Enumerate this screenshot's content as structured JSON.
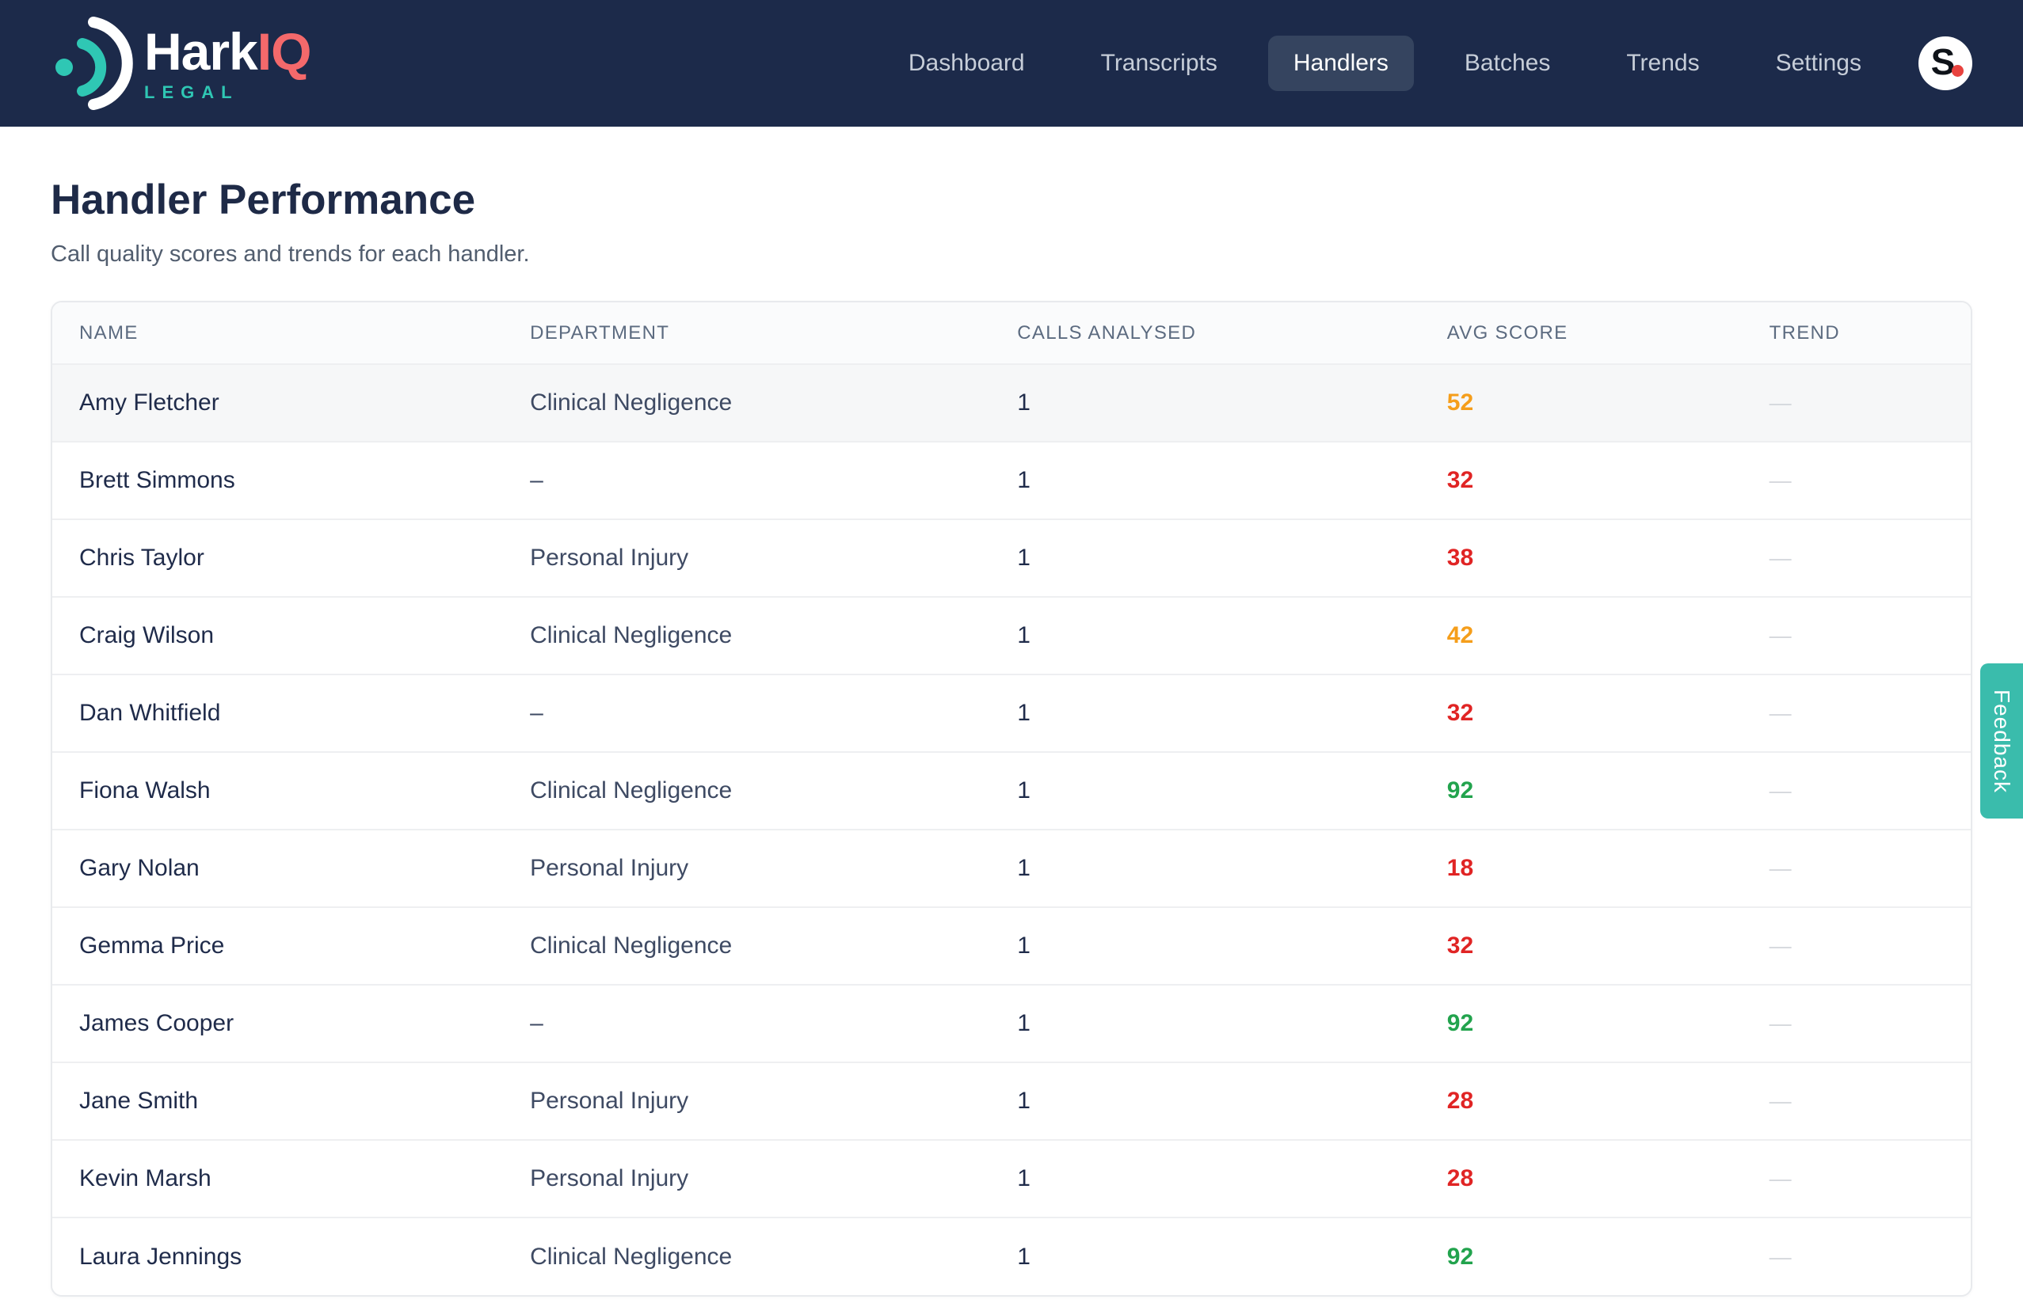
{
  "brand": {
    "name_primary": "Hark",
    "name_secondary": "IQ",
    "tagline": "LEGAL",
    "colors": {
      "navy": "#1C2A4A",
      "teal": "#2FC7B4",
      "coral": "#F4696B"
    }
  },
  "nav": {
    "items": [
      {
        "label": "Dashboard",
        "active": false
      },
      {
        "label": "Transcripts",
        "active": false
      },
      {
        "label": "Handlers",
        "active": true
      },
      {
        "label": "Batches",
        "active": false
      },
      {
        "label": "Trends",
        "active": false
      },
      {
        "label": "Settings",
        "active": false
      }
    ],
    "avatar_letter": "S"
  },
  "page": {
    "title": "Handler Performance",
    "subtitle": "Call quality scores and trends for each handler."
  },
  "table": {
    "columns": [
      "Name",
      "Department",
      "Calls Analysed",
      "Avg Score",
      "Trend"
    ],
    "score_colors": {
      "low": "#E02424",
      "mid": "#F59E1B",
      "high": "#22A34D"
    },
    "rows": [
      {
        "name": "Amy Fletcher",
        "department": "Clinical Negligence",
        "calls": "1",
        "score": "52",
        "score_color": "#F59E1B",
        "trend": "—",
        "highlighted": true
      },
      {
        "name": "Brett Simmons",
        "department": "–",
        "calls": "1",
        "score": "32",
        "score_color": "#E02424",
        "trend": "—",
        "highlighted": false
      },
      {
        "name": "Chris Taylor",
        "department": "Personal Injury",
        "calls": "1",
        "score": "38",
        "score_color": "#E02424",
        "trend": "—",
        "highlighted": false
      },
      {
        "name": "Craig Wilson",
        "department": "Clinical Negligence",
        "calls": "1",
        "score": "42",
        "score_color": "#F59E1B",
        "trend": "—",
        "highlighted": false
      },
      {
        "name": "Dan Whitfield",
        "department": "–",
        "calls": "1",
        "score": "32",
        "score_color": "#E02424",
        "trend": "—",
        "highlighted": false
      },
      {
        "name": "Fiona Walsh",
        "department": "Clinical Negligence",
        "calls": "1",
        "score": "92",
        "score_color": "#22A34D",
        "trend": "—",
        "highlighted": false
      },
      {
        "name": "Gary Nolan",
        "department": "Personal Injury",
        "calls": "1",
        "score": "18",
        "score_color": "#E02424",
        "trend": "—",
        "highlighted": false
      },
      {
        "name": "Gemma Price",
        "department": "Clinical Negligence",
        "calls": "1",
        "score": "32",
        "score_color": "#E02424",
        "trend": "—",
        "highlighted": false
      },
      {
        "name": "James Cooper",
        "department": "–",
        "calls": "1",
        "score": "92",
        "score_color": "#22A34D",
        "trend": "—",
        "highlighted": false
      },
      {
        "name": "Jane Smith",
        "department": "Personal Injury",
        "calls": "1",
        "score": "28",
        "score_color": "#E02424",
        "trend": "—",
        "highlighted": false
      },
      {
        "name": "Kevin Marsh",
        "department": "Personal Injury",
        "calls": "1",
        "score": "28",
        "score_color": "#E02424",
        "trend": "—",
        "highlighted": false
      },
      {
        "name": "Laura Jennings",
        "department": "Clinical Negligence",
        "calls": "1",
        "score": "92",
        "score_color": "#22A34D",
        "trend": "—",
        "highlighted": false
      }
    ]
  },
  "feedback_tab": {
    "label": "Feedback",
    "color": "#3ABCAC"
  }
}
